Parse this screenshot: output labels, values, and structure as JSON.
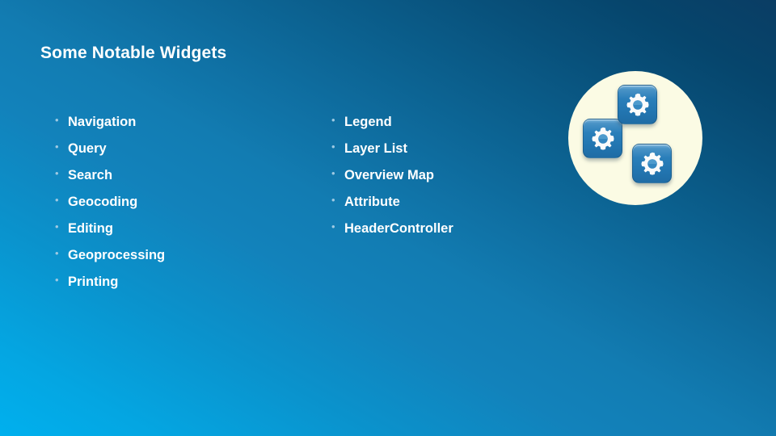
{
  "slide": {
    "title": "Some Notable Widgets",
    "background": {
      "gradient_from": "#00b0ee",
      "gradient_to": "#0a3d64"
    }
  },
  "bullets": {
    "marker_glyph": "•",
    "marker_color": "#9ec9e2",
    "text_color": "#ffffff",
    "left_column": [
      {
        "label": "Navigation"
      },
      {
        "label": "Query"
      },
      {
        "label": "Search"
      },
      {
        "label": "Geocoding"
      },
      {
        "label": "Editing"
      },
      {
        "label": "Geoprocessing"
      },
      {
        "label": "Printing"
      }
    ],
    "right_column": [
      {
        "label": "Legend"
      },
      {
        "label": "Layer List"
      },
      {
        "label": "Overview Map"
      },
      {
        "label": "Attribute"
      },
      {
        "label": "HeaderController"
      }
    ]
  },
  "graphic": {
    "name": "three-gear-tiles",
    "circle_color": "#fbfbe4",
    "tile_color": "#2a7fba",
    "gear_color": "#ffffff",
    "tiles": [
      {
        "icon": "gear-icon"
      },
      {
        "icon": "gear-icon"
      },
      {
        "icon": "gear-icon"
      }
    ]
  }
}
